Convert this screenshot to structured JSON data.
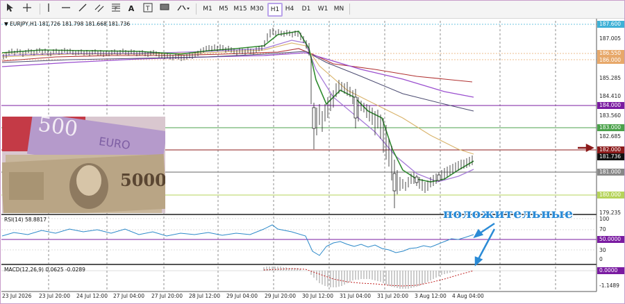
{
  "toolbar": {
    "timeframes": [
      "M1",
      "M5",
      "M15",
      "M30",
      "H1",
      "H4",
      "D1",
      "W1",
      "MN"
    ],
    "active_timeframe": "H1"
  },
  "main_chart": {
    "header": "▼ EURJPY,H1  181.726 181.798 181.668 181.736",
    "price_labels": [
      "187.600",
      "187.005",
      "186.000",
      "185.285",
      "184.410",
      "184.000",
      "183.560",
      "183.000",
      "182.685",
      "182.000",
      "181.736",
      "181.000",
      "180.000",
      "179.235"
    ],
    "tag_187_600": "187.600",
    "tag_184": "184.000",
    "tag_183": "183.000",
    "tag_182": "182.000",
    "tag_current": "181.736",
    "tag_181": "181.000",
    "tag_180": "180.000",
    "tag_186": "186.000",
    "tag_186_5": "186.550"
  },
  "rsi_panel": {
    "header": "RSI(14) 58.8817",
    "levels": [
      "100",
      "70",
      "50.0000",
      "30",
      "0"
    ]
  },
  "macd_panel": {
    "header": "MACD(12,26,9) 0.0625 -0.0289",
    "levels": [
      "0.0000",
      "-1.1489"
    ]
  },
  "time_axis": [
    "23 Jul 2026",
    "23 Jul 20:00",
    "24 Jul 12:00",
    "27 Jul 04:00",
    "27 Jul 20:00",
    "28 Jul 12:00",
    "29 Jul 04:00",
    "29 Jul 20:00",
    "30 Jul 12:00",
    "31 Jul 04:00",
    "31 Jul 20:00",
    "3 Aug 12:00",
    "4 Aug 04:00"
  ],
  "annotation": "положительные",
  "colors": {
    "accent_toolbar": "#b9a3ea",
    "level_cyan": "#3fb1d6",
    "level_purple": "#7a1ba1",
    "level_green": "#4ba24b",
    "level_darkred": "#8b1a1a",
    "level_lime": "#b5d35a",
    "annotation_blue": "#2b8bd6"
  }
}
